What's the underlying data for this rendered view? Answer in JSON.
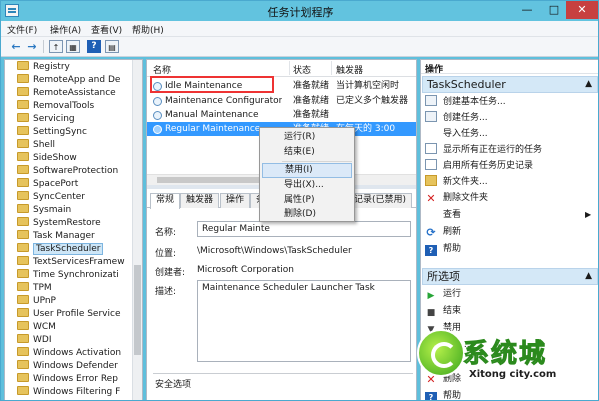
{
  "window": {
    "title": "任务计划程序",
    "controls": [
      "—",
      "□",
      "✕"
    ]
  },
  "menu": [
    "文件(F)",
    "操作(A)",
    "查看(V)",
    "帮助(H)"
  ],
  "toolbar": {
    "back": "←",
    "forward": "→",
    "help": "?"
  },
  "tree": {
    "items": [
      "Registry",
      "RemoteApp and De",
      "RemoteAssistance",
      "RemovalTools",
      "Servicing",
      "SettingSync",
      "Shell",
      "SideShow",
      "SoftwareProtection",
      "SpacePort",
      "SyncCenter",
      "Sysmain",
      "SystemRestore",
      "Task Manager",
      "TaskScheduler",
      "TextServicesFramew",
      "Time Synchronizati",
      "TPM",
      "UPnP",
      "User Profile Service",
      "WCM",
      "WDI",
      "Windows Activation",
      "Windows Defender",
      "Windows Error Rep",
      "Windows Filtering F"
    ],
    "selected": "TaskScheduler"
  },
  "tasklist": {
    "columns": [
      "名称",
      "状态",
      "触发器"
    ],
    "rows": [
      {
        "name": "Idle Maintenance",
        "status": "准备就绪",
        "trigger": "当计算机空闲时"
      },
      {
        "name": "Maintenance Configurator",
        "status": "准备就绪",
        "trigger": "已定义多个触发器"
      },
      {
        "name": "Manual Maintenance",
        "status": "准备就绪",
        "trigger": ""
      },
      {
        "name": "Regular Maintenance",
        "status": "准备就绪",
        "trigger": "在每天的 3:00"
      }
    ],
    "selected": "Regular Maintenance",
    "highlighted": "Idle Maintenance"
  },
  "context_menu": {
    "items": [
      "运行(R)",
      "结束(E)",
      "禁用(I)",
      "导出(X)...",
      "属性(P)",
      "删除(D)"
    ],
    "hover": "禁用(I)"
  },
  "tabs": [
    "常规",
    "触发器",
    "操作",
    "条",
    "历史记录(已禁用)"
  ],
  "active_tab": "常规",
  "properties": {
    "name_label": "名称:",
    "name_value": "Regular Mainte",
    "location_label": "位置:",
    "location_value": "\\Microsoft\\Windows\\TaskScheduler",
    "author_label": "创建者:",
    "author_value": "Microsoft Corporation",
    "desc_label": "描述:",
    "desc_value": "Maintenance Scheduler Launcher Task",
    "security_label": "安全选项"
  },
  "actions": {
    "header": "操作",
    "section1": {
      "title": "TaskScheduler",
      "items": [
        "创建基本任务...",
        "创建任务...",
        "导入任务...",
        "显示所有正在运行的任务",
        "启用所有任务历史记录",
        "新文件夹...",
        "删除文件夹",
        "查看",
        "刷新",
        "帮助"
      ]
    },
    "section2": {
      "title": "所选项",
      "items": [
        "运行",
        "结束",
        "禁用",
        "导出...",
        "属性",
        "删除",
        "帮助"
      ]
    }
  },
  "watermark": {
    "brand": "系统城",
    "url": "Xitong city.com"
  },
  "colors": {
    "titlebar": "#62c3df",
    "selection": "#3399ff",
    "section_header": "#d4e8f7",
    "highlight_box": "#ee3333",
    "close_button": "#c74040"
  }
}
